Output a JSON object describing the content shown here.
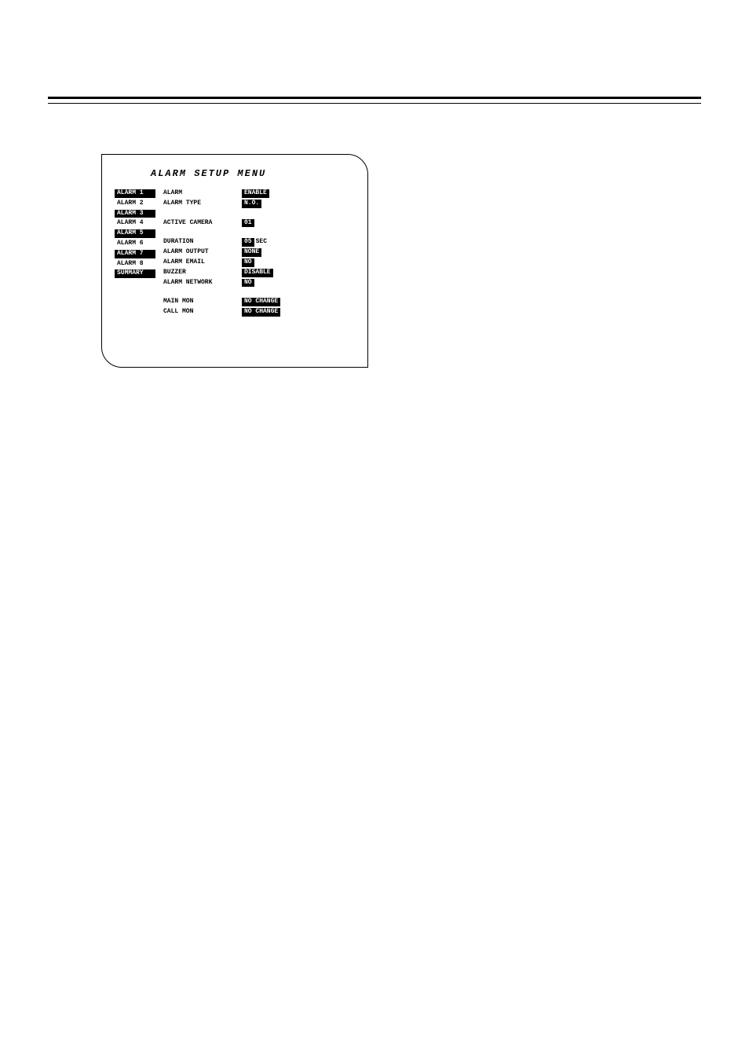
{
  "menu": {
    "title": "ALARM SETUP MENU",
    "nav": [
      {
        "label": "ALARM 1",
        "active": true
      },
      {
        "label": "ALARM 2",
        "active": false
      },
      {
        "label": "ALARM 3",
        "active": true
      },
      {
        "label": "ALARM 4",
        "active": false
      },
      {
        "label": "ALARM 5",
        "active": true
      },
      {
        "label": "ALARM 6",
        "active": false
      },
      {
        "label": "ALARM 7",
        "active": true
      },
      {
        "label": "ALARM 8",
        "active": false
      },
      {
        "label": "SUMMARY",
        "active": true
      }
    ],
    "rows": [
      {
        "label": "ALARM",
        "value": "ENABLE"
      },
      {
        "label": "ALARM TYPE",
        "value": "N.O."
      },
      {
        "gap": true
      },
      {
        "label": "ACTIVE CAMERA",
        "value": "01"
      },
      {
        "gap": true
      },
      {
        "label": "DURATION",
        "value": "05",
        "suffix": "SEC"
      },
      {
        "label": "ALARM OUTPUT",
        "value": "NONE"
      },
      {
        "label": "ALARM EMAIL",
        "value": "NO"
      },
      {
        "label": "BUZZER",
        "value": "DISABLE"
      },
      {
        "label": "ALARM NETWORK",
        "value": "NO"
      },
      {
        "gap2": true
      },
      {
        "label": "MAIN MON",
        "value": "NO CHANGE"
      },
      {
        "label": "CALL MON",
        "value": "NO CHANGE"
      }
    ]
  }
}
